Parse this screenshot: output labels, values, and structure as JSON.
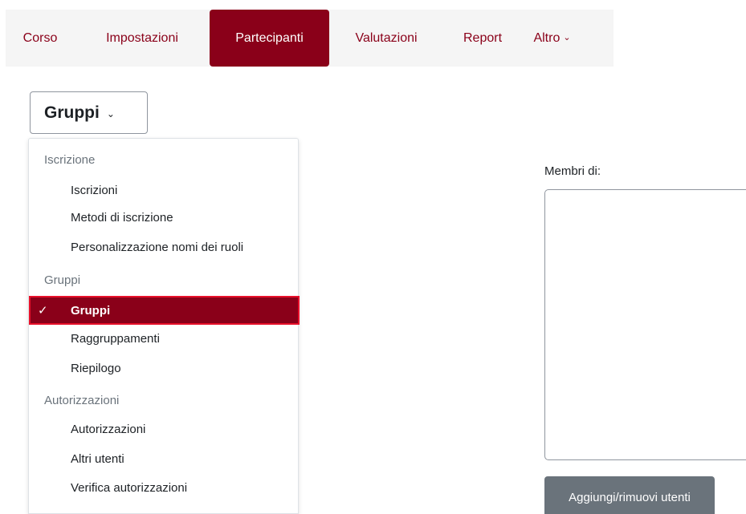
{
  "topnav": {
    "tabs": [
      {
        "label": "Corso"
      },
      {
        "label": "Impostazioni"
      },
      {
        "label": "Partecipanti"
      },
      {
        "label": "Valutazioni"
      },
      {
        "label": "Report"
      },
      {
        "label": "Altro"
      }
    ],
    "active_tab": "Partecipanti"
  },
  "dropdown": {
    "selected_label": "Gruppi",
    "chevron_icon": "chevron-down-icon"
  },
  "menu": {
    "sections": [
      {
        "header": "Iscrizione",
        "items": [
          "Iscrizioni",
          "Metodi di iscrizione",
          "Personalizzazione nomi dei ruoli"
        ]
      },
      {
        "header": "Gruppi",
        "items": [
          "Gruppi",
          "Raggruppamenti",
          "Riepilogo"
        ]
      },
      {
        "header": "Autorizzazioni",
        "items": [
          "Autorizzazioni",
          "Altri utenti",
          "Verifica autorizzazioni"
        ]
      }
    ],
    "selected_item": "Gruppi",
    "check_icon": "check-icon"
  },
  "members": {
    "label": "Membri di:",
    "add_remove_button": "Aggiungi/rimuovi utenti"
  },
  "colors": {
    "brand": "#8a0019",
    "selected_outline": "#e8102a",
    "button_gray": "#6a737b"
  }
}
